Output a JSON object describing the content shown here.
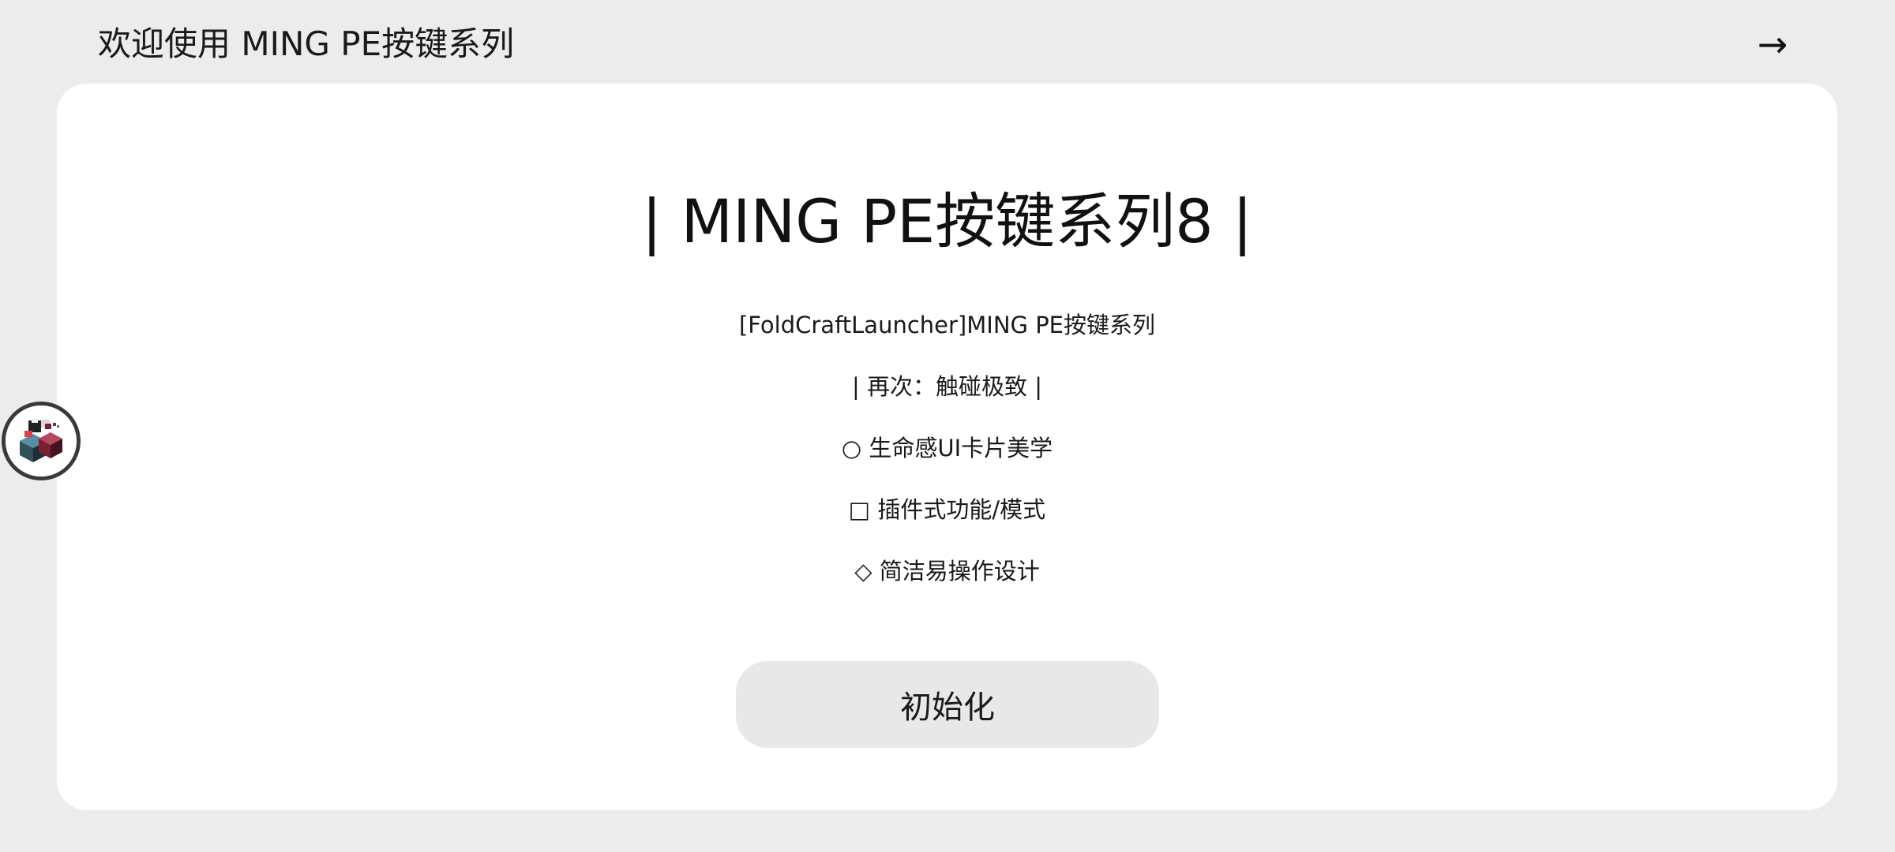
{
  "header": {
    "title": "欢迎使用 MING PE按键系列",
    "next_icon": "→"
  },
  "card": {
    "title": "| MING PE按键系列8 |",
    "lines": [
      "[FoldCraftLauncher]MING PE按键系列",
      "| 再次：触碰极致 |",
      "○ 生命感UI卡片美学",
      "□ 插件式功能/模式",
      "◇ 简洁易操作设计"
    ],
    "button_label": "初始化"
  },
  "colors": {
    "page_background": "#ececec",
    "card_background": "#ffffff",
    "button_background": "#e8e8e8",
    "text": "#111111"
  },
  "icons": {
    "next": "arrow-right-icon",
    "avatar": "floating-avatar-icon"
  }
}
